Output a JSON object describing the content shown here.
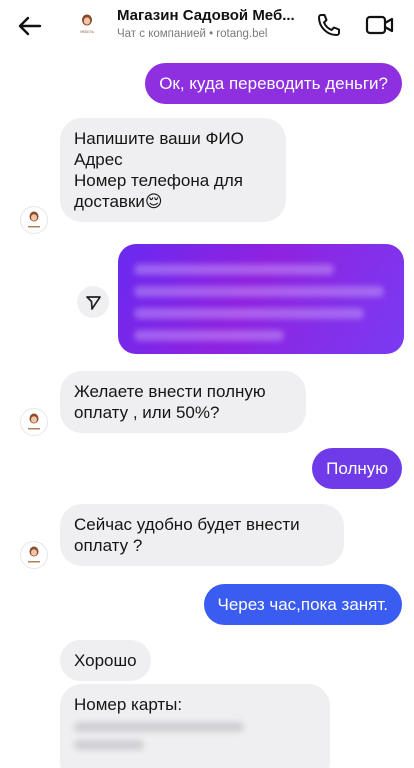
{
  "header": {
    "title": "Магазин Садовой Меб...",
    "subtitle": "Чат с компанией • rotang.bel",
    "avatar_label": "МЕБЕЛЬ"
  },
  "messages": [
    {
      "id": "m1",
      "side": "out",
      "text": "Ок, куда переводить деньги?"
    },
    {
      "id": "m2",
      "side": "in",
      "text": "Напишите ваши ФИО\nАдрес\nНомер телефона для доставки😌"
    },
    {
      "id": "m3",
      "side": "out",
      "type": "forwarded-blurred",
      "text": ""
    },
    {
      "id": "m4",
      "side": "in",
      "text": "Желаете внести полную оплату , или 50%?"
    },
    {
      "id": "m5",
      "side": "out",
      "text": "Полную"
    },
    {
      "id": "m6",
      "side": "in",
      "text": "Сейчас удобно будет внести оплату ?"
    },
    {
      "id": "m7",
      "side": "out",
      "text": "Через час,пока занят."
    },
    {
      "id": "m8",
      "side": "in",
      "text": "Хорошо"
    },
    {
      "id": "m9",
      "side": "in",
      "text": "Номер карты:"
    }
  ],
  "colors": {
    "out_purple": "#8e2fe0",
    "out_violet": "#6f3be8",
    "out_blue": "#3a5cf0",
    "out_blue_light": "#3470f0",
    "in_bg": "#efeff1"
  },
  "icons": [
    "back-arrow-icon",
    "phone-icon",
    "video-icon",
    "share-icon"
  ]
}
